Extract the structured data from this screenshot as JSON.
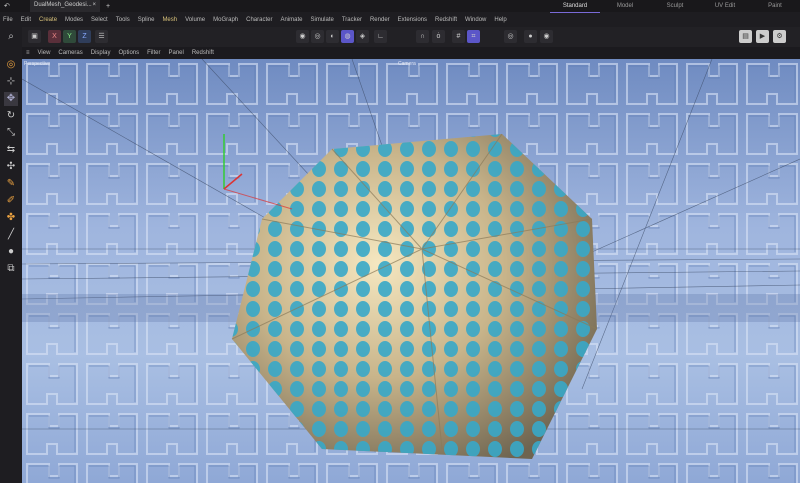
{
  "titlebar": {
    "tab": "DualMesh_Geodesi...",
    "close": "×",
    "plus": "+"
  },
  "layouts": [
    "Standard",
    "Model",
    "Sculpt",
    "UV Edit",
    "Paint"
  ],
  "menu": [
    "File",
    "Edit",
    "Create",
    "Modes",
    "Select",
    "Tools",
    "Spline",
    "Mesh",
    "Volume",
    "MoGraph",
    "Character",
    "Animate",
    "Simulate",
    "Tracker",
    "Render",
    "Extensions",
    "Redshift",
    "Window",
    "Help"
  ],
  "axes": {
    "x": "X",
    "y": "Y",
    "z": "Z"
  },
  "viewport_menu": [
    "View",
    "Cameras",
    "Display",
    "Options",
    "Filter",
    "Panel",
    "Redshift"
  ],
  "viewport": {
    "label_left": "Perspective",
    "label_camera": "Camera"
  }
}
